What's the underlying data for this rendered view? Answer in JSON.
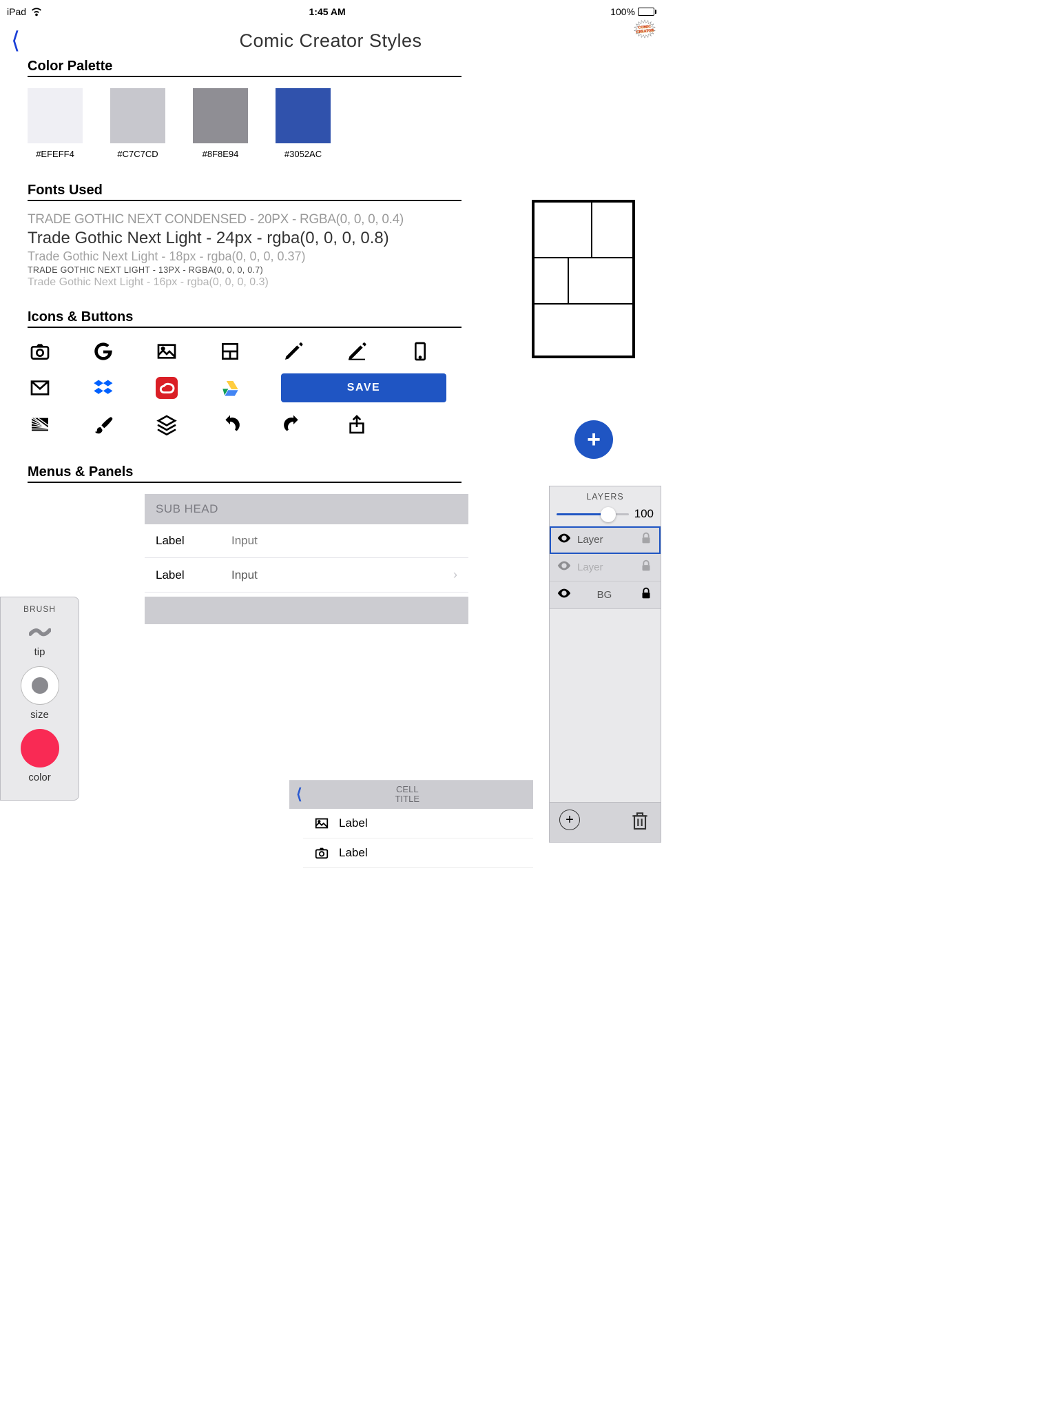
{
  "statusbar": {
    "device": "iPad",
    "time": "1:45 AM",
    "battery": "100%"
  },
  "header": {
    "title": "Comic Creator Styles"
  },
  "logo": {
    "line1": "COMIC",
    "line2": "CREATOR"
  },
  "sections": {
    "palette": "Color Palette",
    "fonts": "Fonts Used",
    "icons": "Icons & Buttons",
    "menus": "Menus & Panels"
  },
  "palette": [
    {
      "hex": "#EFEFF4"
    },
    {
      "hex": "#C7C7CD"
    },
    {
      "hex": "#8F8E94"
    },
    {
      "hex": "#3052AC"
    }
  ],
  "fontlines": {
    "l1": "TRADE GOTHIC NEXT CONDENSED - 20PX - RGBA(0, 0, 0, 0.4)",
    "l2": "Trade Gothic Next Light - 24px - rgba(0, 0, 0, 0.8)",
    "l3": "Trade Gothic Next Light - 18px - rgba(0, 0, 0, 0.37)",
    "l4": "TRADE GOTHIC NEXT LIGHT - 13PX - RGBA(0, 0, 0, 0.7)",
    "l5": "Trade Gothic Next Light - 16px - rgba(0, 0, 0, 0.3)"
  },
  "save_btn": "SAVE",
  "brush": {
    "title": "BRUSH",
    "tip": "tip",
    "size": "size",
    "color": "color"
  },
  "form": {
    "subhead": "SUB HEAD",
    "label": "Label",
    "input": "Input"
  },
  "cellpanel": {
    "title": "CELL\nTITLE",
    "label": "Label"
  },
  "layers": {
    "title": "LAYERS",
    "opacity": "100",
    "rows": [
      {
        "name": "Layer"
      },
      {
        "name": "Layer"
      },
      {
        "name": "BG"
      }
    ]
  }
}
